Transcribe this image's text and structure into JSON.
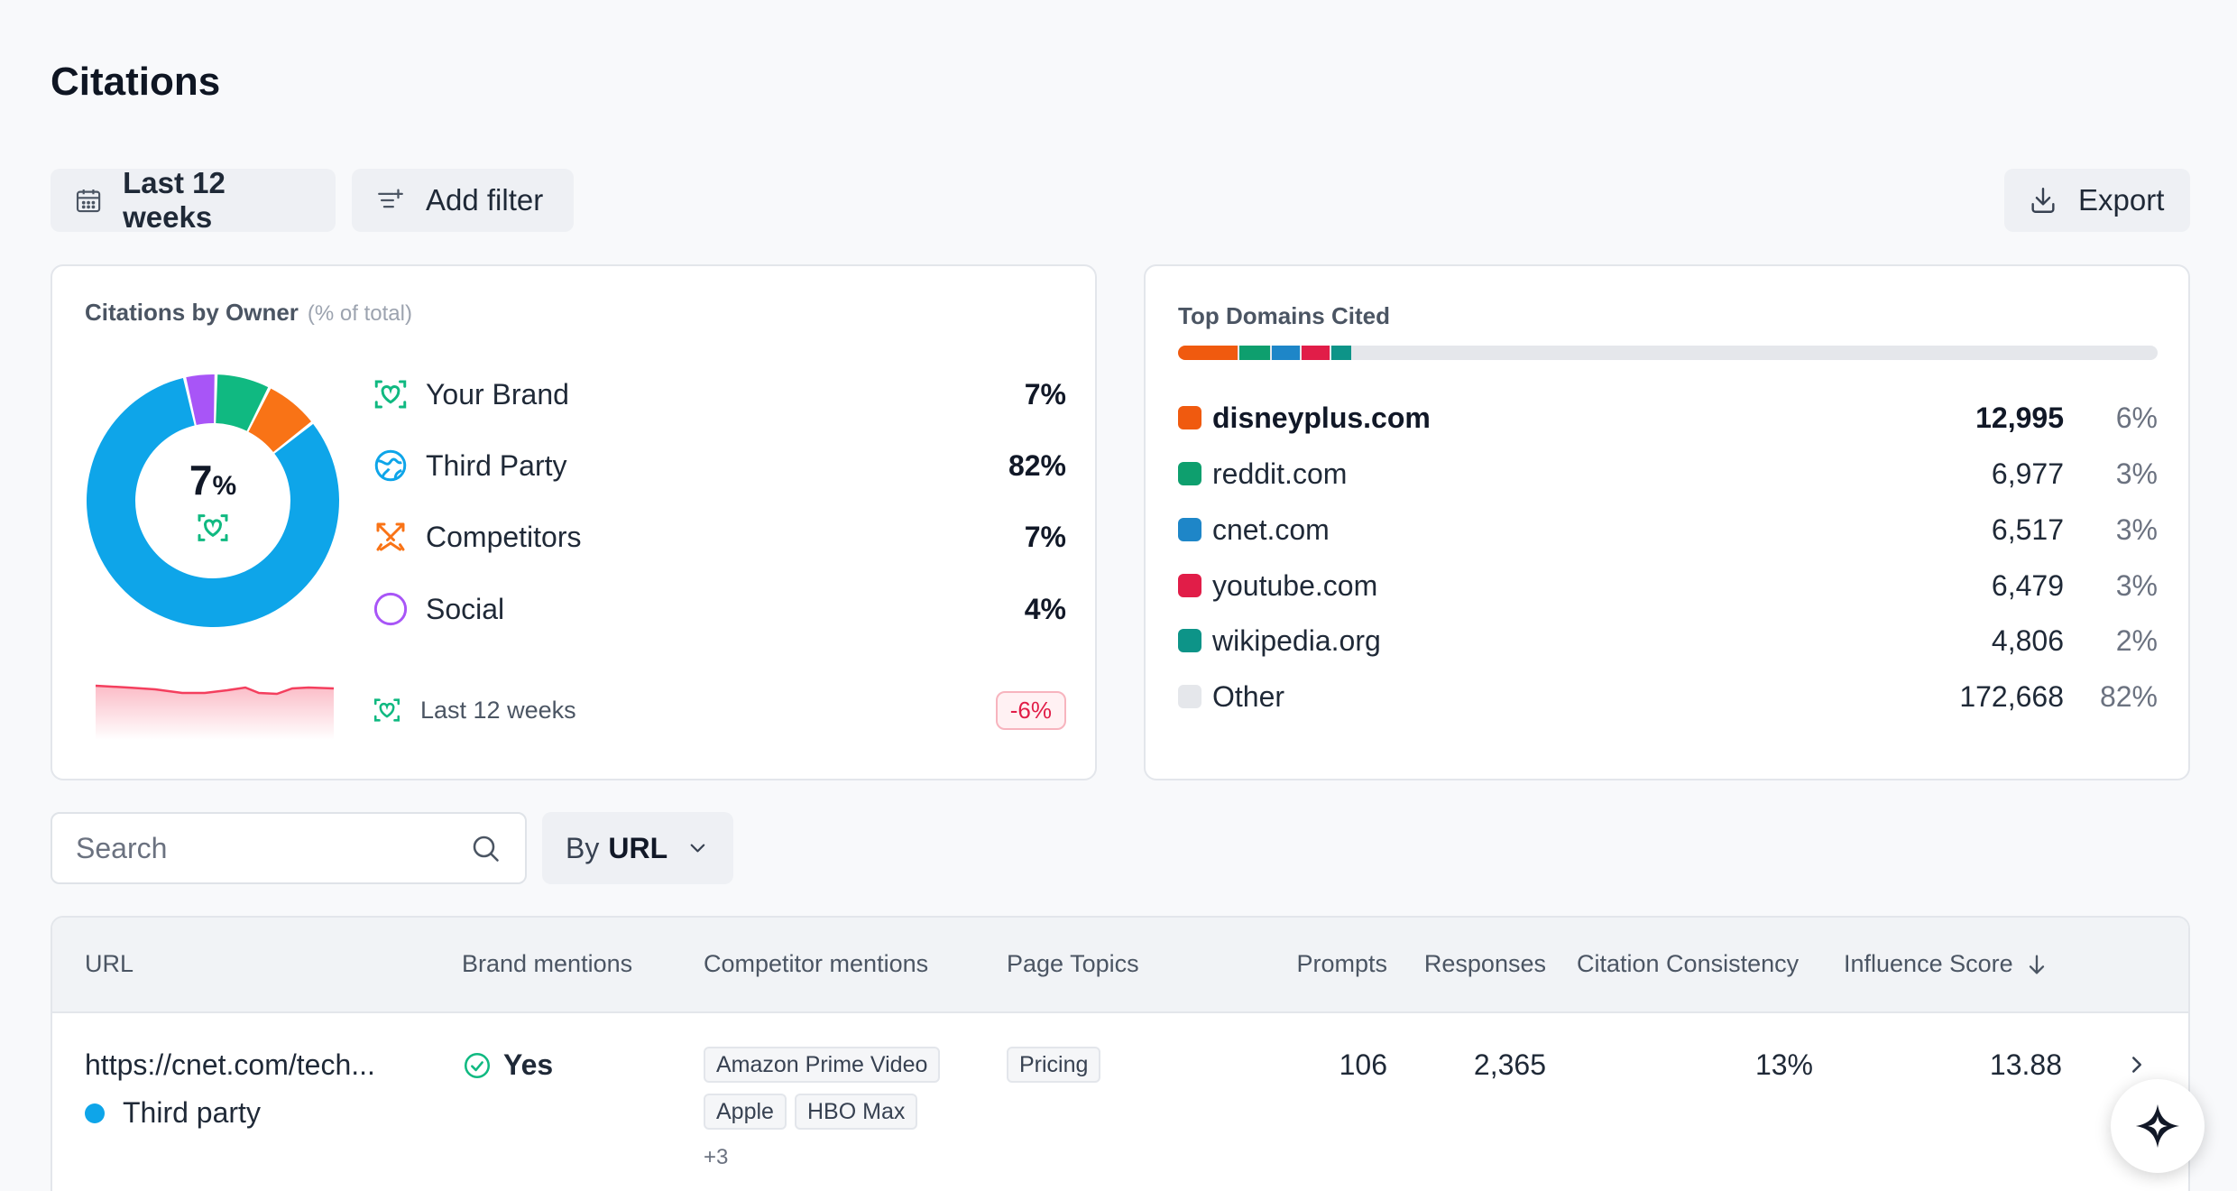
{
  "page": {
    "title": "Citations"
  },
  "toolbar": {
    "date_range_label": "Last 12 weeks",
    "add_filter_label": "Add filter",
    "export_label": "Export"
  },
  "owner_card": {
    "title": "Citations by Owner",
    "subtitle": "(% of total)",
    "center_value": "7",
    "center_unit": "%",
    "legend": [
      {
        "label": "Your Brand",
        "pct": "7%",
        "value": 7,
        "color": "#10b981",
        "icon": "brand-heart-icon"
      },
      {
        "label": "Third Party",
        "pct": "82%",
        "value": 82,
        "color": "#0ea5e9",
        "icon": "globe-icon"
      },
      {
        "label": "Competitors",
        "pct": "7%",
        "value": 7,
        "color": "#f97316",
        "icon": "crossed-swords-icon"
      },
      {
        "label": "Social",
        "pct": "4%",
        "value": 4,
        "color": "#a855f7",
        "icon": "circle-icon"
      }
    ],
    "trend": {
      "label": "Last 12 weeks",
      "change": "-6%",
      "color": "#f43f5e"
    }
  },
  "domains_card": {
    "title": "Top Domains Cited",
    "rows": [
      {
        "name": "disneyplus.com",
        "count": "12,995",
        "share": "6%",
        "color": "#f05a0f",
        "bold": true
      },
      {
        "name": "reddit.com",
        "count": "6,977",
        "share": "3%",
        "color": "#0e9f6e",
        "bold": false
      },
      {
        "name": "cnet.com",
        "count": "6,517",
        "share": "3%",
        "color": "#1e86c8",
        "bold": false
      },
      {
        "name": "youtube.com",
        "count": "6,479",
        "share": "3%",
        "color": "#e11d48",
        "bold": false
      },
      {
        "name": "wikipedia.org",
        "count": "4,806",
        "share": "2%",
        "color": "#0d9488",
        "bold": false
      },
      {
        "name": "Other",
        "count": "172,668",
        "share": "82%",
        "color": "#e5e7eb",
        "bold": false
      }
    ]
  },
  "search": {
    "placeholder": "Search",
    "value": ""
  },
  "group_by": {
    "prefix": "By",
    "value": "URL"
  },
  "table": {
    "columns": {
      "url": "URL",
      "brand": "Brand mentions",
      "competitor": "Competitor mentions",
      "topics": "Page Topics",
      "prompts": "Prompts",
      "responses": "Responses",
      "consistency": "Citation Consistency",
      "influence": "Influence Score"
    },
    "rows": [
      {
        "url": "https://cnet.com/tech...",
        "owner": "Third party",
        "brand_mention": "Yes",
        "competitors": [
          "Amazon Prime Video",
          "Apple",
          "HBO Max"
        ],
        "competitors_more": "+3",
        "topics": [
          "Pricing"
        ],
        "prompts": "106",
        "responses": "2,365",
        "consistency": "13%",
        "influence": "13.88"
      }
    ]
  }
}
